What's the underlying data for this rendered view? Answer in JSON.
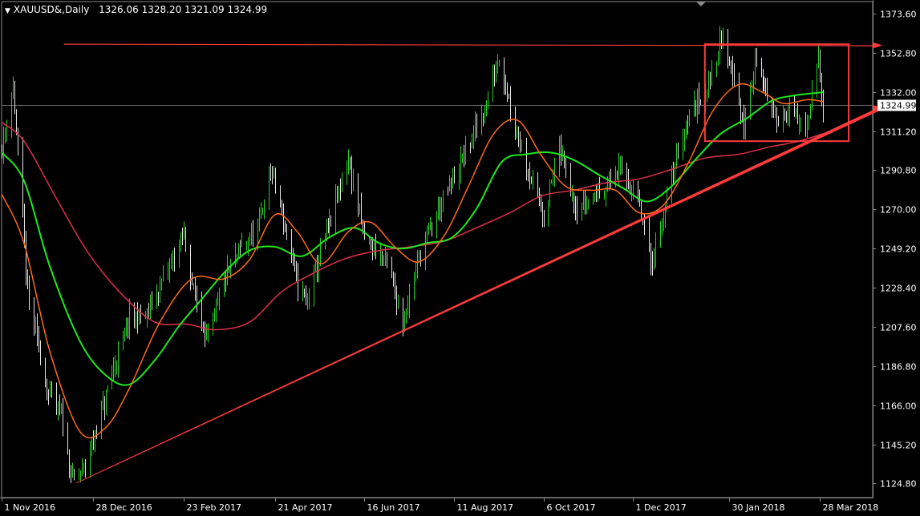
{
  "header": {
    "symbol": "XAUUSD&,Daily",
    "open": "1326.06",
    "high": "1328.20",
    "low": "1321.09",
    "close": "1324.99"
  },
  "price_label": "1324.99",
  "chart_data": {
    "type": "candlestick",
    "title": "",
    "ylim": [
      1117.0,
      1380.0
    ],
    "y_ticks": [
      1124.8,
      1145.2,
      1166.0,
      1186.8,
      1207.6,
      1228.4,
      1249.2,
      1270.0,
      1290.8,
      1311.2,
      1332.0,
      1352.8,
      1373.6
    ],
    "x_tick_labels": [
      "1 Nov 2016",
      "28 Dec 2016",
      "23 Feb 2017",
      "21 Apr 2017",
      "16 Jun 2017",
      "11 Aug 2017",
      "6 Oct 2017",
      "1 Dec 2017",
      "30 Jan 2018",
      "28 Mar 2018"
    ],
    "current_price": 1324.99,
    "colors": {
      "bull": "#26d026",
      "bear": "#e4e4e4",
      "grid": "#555555",
      "annotation": "#ff3b3b",
      "ma_fast": "#ff6a1a",
      "ma_mid": "#1ee81e",
      "ma_slow": "#e0304a"
    },
    "anchors": [
      [
        "2016-11-01",
        1302
      ],
      [
        "2016-11-08",
        1336
      ],
      [
        "2016-11-17",
        1225
      ],
      [
        "2016-11-30",
        1172
      ],
      [
        "2016-12-08",
        1160
      ],
      [
        "2016-12-15",
        1126
      ],
      [
        "2016-12-22",
        1132
      ],
      [
        "2016-12-30",
        1153
      ],
      [
        "2017-01-10",
        1185
      ],
      [
        "2017-01-20",
        1212
      ],
      [
        "2017-01-31",
        1214
      ],
      [
        "2017-02-10",
        1233
      ],
      [
        "2017-02-23",
        1256
      ],
      [
        "2017-03-01",
        1226
      ],
      [
        "2017-03-10",
        1200
      ],
      [
        "2017-03-20",
        1232
      ],
      [
        "2017-03-31",
        1250
      ],
      [
        "2017-04-10",
        1258
      ],
      [
        "2017-04-18",
        1292
      ],
      [
        "2017-04-24",
        1272
      ],
      [
        "2017-05-05",
        1230
      ],
      [
        "2017-05-10",
        1220
      ],
      [
        "2017-05-25",
        1262
      ],
      [
        "2017-06-06",
        1296
      ],
      [
        "2017-06-16",
        1255
      ],
      [
        "2017-06-30",
        1242
      ],
      [
        "2017-07-10",
        1210
      ],
      [
        "2017-07-20",
        1245
      ],
      [
        "2017-07-31",
        1268
      ],
      [
        "2017-08-10",
        1285
      ],
      [
        "2017-08-18",
        1300
      ],
      [
        "2017-08-31",
        1325
      ],
      [
        "2017-09-08",
        1352
      ],
      [
        "2017-09-15",
        1325
      ],
      [
        "2017-09-25",
        1294
      ],
      [
        "2017-10-06",
        1266
      ],
      [
        "2017-10-16",
        1302
      ],
      [
        "2017-10-27",
        1270
      ],
      [
        "2017-11-10",
        1280
      ],
      [
        "2017-11-24",
        1292
      ],
      [
        "2017-12-04",
        1274
      ],
      [
        "2017-12-12",
        1241
      ],
      [
        "2017-12-20",
        1266
      ],
      [
        "2017-12-29",
        1302
      ],
      [
        "2018-01-05",
        1320
      ],
      [
        "2018-01-16",
        1335
      ],
      [
        "2018-01-25",
        1360
      ],
      [
        "2018-02-01",
        1344
      ],
      [
        "2018-02-08",
        1312
      ],
      [
        "2018-02-16",
        1352
      ],
      [
        "2018-02-27",
        1318
      ],
      [
        "2018-03-09",
        1322
      ],
      [
        "2018-03-20",
        1311
      ],
      [
        "2018-03-27",
        1352
      ],
      [
        "2018-03-30",
        1325
      ]
    ],
    "moving_averages": [
      {
        "key": "ma_fast",
        "points": [
          [
            "2016-11-01",
            1278
          ],
          [
            "2016-11-15",
            1252
          ],
          [
            "2016-12-01",
            1195
          ],
          [
            "2016-12-20",
            1152
          ],
          [
            "2017-01-05",
            1154
          ],
          [
            "2017-01-20",
            1175
          ],
          [
            "2017-02-08",
            1210
          ],
          [
            "2017-02-28",
            1233
          ],
          [
            "2017-03-20",
            1233
          ],
          [
            "2017-04-05",
            1243
          ],
          [
            "2017-04-21",
            1267
          ],
          [
            "2017-05-05",
            1258
          ],
          [
            "2017-05-20",
            1241
          ],
          [
            "2017-06-06",
            1258
          ],
          [
            "2017-06-20",
            1263
          ],
          [
            "2017-07-05",
            1250
          ],
          [
            "2017-07-20",
            1242
          ],
          [
            "2017-08-05",
            1256
          ],
          [
            "2017-08-20",
            1282
          ],
          [
            "2017-09-05",
            1310
          ],
          [
            "2017-09-20",
            1317
          ],
          [
            "2017-10-05",
            1298
          ],
          [
            "2017-10-20",
            1282
          ],
          [
            "2017-11-05",
            1280
          ],
          [
            "2017-11-20",
            1280
          ],
          [
            "2017-12-05",
            1268
          ],
          [
            "2017-12-20",
            1272
          ],
          [
            "2018-01-05",
            1295
          ],
          [
            "2018-01-20",
            1322
          ],
          [
            "2018-02-05",
            1336
          ],
          [
            "2018-02-20",
            1332
          ],
          [
            "2018-03-05",
            1326
          ],
          [
            "2018-03-20",
            1328
          ],
          [
            "2018-03-30",
            1327
          ]
        ]
      },
      {
        "key": "ma_mid",
        "points": [
          [
            "2016-11-01",
            1300
          ],
          [
            "2016-11-15",
            1285
          ],
          [
            "2016-12-01",
            1240
          ],
          [
            "2016-12-20",
            1200
          ],
          [
            "2017-01-05",
            1182
          ],
          [
            "2017-01-20",
            1177
          ],
          [
            "2017-02-05",
            1190
          ],
          [
            "2017-02-20",
            1208
          ],
          [
            "2017-03-05",
            1221
          ],
          [
            "2017-03-20",
            1236
          ],
          [
            "2017-04-05",
            1248
          ],
          [
            "2017-04-21",
            1250
          ],
          [
            "2017-05-08",
            1245
          ],
          [
            "2017-05-25",
            1255
          ],
          [
            "2017-06-10",
            1260
          ],
          [
            "2017-06-25",
            1252
          ],
          [
            "2017-07-10",
            1249
          ],
          [
            "2017-07-25",
            1252
          ],
          [
            "2017-08-10",
            1255
          ],
          [
            "2017-08-25",
            1270
          ],
          [
            "2017-09-10",
            1295
          ],
          [
            "2017-09-25",
            1299
          ],
          [
            "2017-10-10",
            1300
          ],
          [
            "2017-10-25",
            1296
          ],
          [
            "2017-11-10",
            1288
          ],
          [
            "2017-11-25",
            1281
          ],
          [
            "2017-12-10",
            1274
          ],
          [
            "2017-12-25",
            1282
          ],
          [
            "2018-01-10",
            1297
          ],
          [
            "2018-01-25",
            1310
          ],
          [
            "2018-02-10",
            1318
          ],
          [
            "2018-02-25",
            1327
          ],
          [
            "2018-03-10",
            1330
          ],
          [
            "2018-03-30",
            1332
          ]
        ]
      },
      {
        "key": "ma_slow",
        "points": [
          [
            "2016-11-01",
            1316
          ],
          [
            "2016-11-15",
            1306
          ],
          [
            "2016-12-05",
            1276
          ],
          [
            "2016-12-25",
            1247
          ],
          [
            "2017-01-15",
            1225
          ],
          [
            "2017-02-05",
            1210
          ],
          [
            "2017-02-25",
            1209
          ],
          [
            "2017-03-15",
            1206
          ],
          [
            "2017-04-05",
            1210
          ],
          [
            "2017-04-25",
            1226
          ],
          [
            "2017-05-15",
            1236
          ],
          [
            "2017-06-05",
            1244
          ],
          [
            "2017-06-25",
            1248
          ],
          [
            "2017-07-15",
            1250
          ],
          [
            "2017-08-05",
            1253
          ],
          [
            "2017-08-25",
            1260
          ],
          [
            "2017-09-15",
            1268
          ],
          [
            "2017-10-05",
            1277
          ],
          [
            "2017-10-25",
            1280
          ],
          [
            "2017-11-15",
            1284
          ],
          [
            "2017-12-05",
            1286
          ],
          [
            "2017-12-25",
            1291
          ],
          [
            "2018-01-15",
            1297
          ],
          [
            "2018-02-05",
            1299
          ],
          [
            "2018-02-25",
            1303
          ],
          [
            "2018-03-15",
            1306
          ],
          [
            "2018-03-30",
            1310
          ]
        ]
      }
    ],
    "annotations": {
      "horizontal_resistance": {
        "from": [
          "2016-12-10",
          1356.8
        ],
        "to": [
          "2018-05-05",
          1356.8
        ]
      },
      "trendline": {
        "from": [
          "2016-12-18",
          1124.8
        ],
        "to": [
          "2018-05-05",
          1323.5
        ]
      },
      "range_box": {
        "x0": "2018-01-15",
        "x1": "2018-04-15",
        "y0": 1306.0,
        "y1": 1357.4
      }
    }
  }
}
